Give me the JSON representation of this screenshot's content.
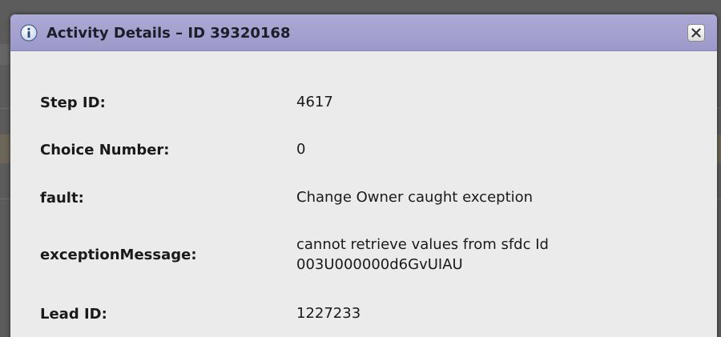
{
  "dialog": {
    "title": "Activity Details – ID 39320168",
    "icons": {
      "info": "info-icon",
      "close": "close-icon"
    }
  },
  "details": [
    {
      "label": "Step ID:",
      "value_lines": [
        "4617"
      ]
    },
    {
      "label": "Choice Number:",
      "value_lines": [
        "0"
      ]
    },
    {
      "label": "fault:",
      "value_lines": [
        "Change Owner caught exception"
      ]
    },
    {
      "label": "exceptionMessage:",
      "value_lines": [
        "cannot retrieve values from sfdc Id",
        "003U000000d6GvUIAU"
      ]
    },
    {
      "label": "Lead ID:",
      "value_lines": [
        "1227233"
      ]
    }
  ],
  "colors": {
    "titlebar": "#a6a2d0",
    "dialog_background": "#ebebeb",
    "overlay": "#5b5b5b"
  }
}
